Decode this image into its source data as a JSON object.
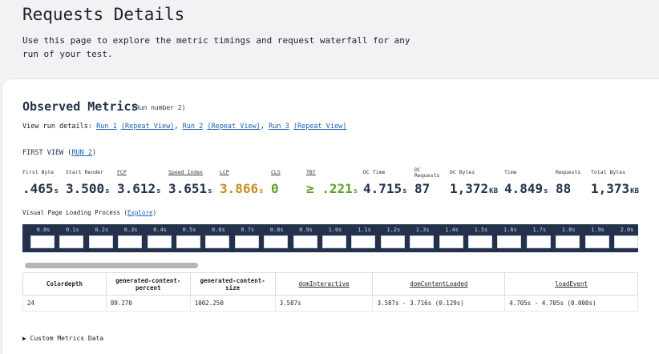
{
  "page": {
    "title": "Requests Details",
    "description": "Use this page to explore the metric timings and request waterfall for any run of your test."
  },
  "observed": {
    "title": "Observed Metrics",
    "run_number": "(Run number 2)",
    "run_details_label": "View run details:",
    "runs": [
      {
        "label": "Run 1",
        "repeat": "(Repeat View)"
      },
      {
        "label": "Run 2",
        "repeat": "(Repeat View)"
      },
      {
        "label": "Run 3",
        "repeat": "(Repeat View)"
      }
    ],
    "first_view_label": "FIRST VIEW",
    "first_view_run": "RUN 2"
  },
  "metrics": [
    {
      "label": "First Byte",
      "value": ".465",
      "unit": "s",
      "color": "#23324a"
    },
    {
      "label": "Start Render",
      "value": "3.500",
      "unit": "s",
      "color": "#23324a"
    },
    {
      "label": "FCP",
      "value": "3.612",
      "unit": "s",
      "color": "#23324a"
    },
    {
      "label": "Speed Index",
      "value": "3.651",
      "unit": "s",
      "color": "#23324a"
    },
    {
      "label": "LCP",
      "value": "3.866",
      "unit": "s",
      "color": "#c98a1b"
    },
    {
      "label": "CLS",
      "value": "0",
      "unit": "",
      "color": "#5aa02c"
    },
    {
      "label": "TBT",
      "value": "≥ .221",
      "unit": "s",
      "color": "#5aa02c"
    },
    {
      "label": "DC Time",
      "value": "4.715",
      "unit": "s",
      "color": "#23324a"
    },
    {
      "label": "DC Requests",
      "value": "87",
      "unit": "",
      "color": "#23324a"
    },
    {
      "label": "DC Bytes",
      "value": "1,372",
      "unit": "KB",
      "color": "#23324a"
    },
    {
      "label": "Time",
      "value": "4.849",
      "unit": "s",
      "color": "#23324a"
    },
    {
      "label": "Requests",
      "value": "88",
      "unit": "",
      "color": "#23324a"
    },
    {
      "label": "Total Bytes",
      "value": "1,373",
      "unit": "KB",
      "color": "#23324a"
    }
  ],
  "visual": {
    "label": "Visual Page Loading Process",
    "explore_label": "Explore",
    "frames": [
      "0.0s",
      "0.1s",
      "0.2s",
      "0.3s",
      "0.4s",
      "0.5s",
      "0.6s",
      "0.7s",
      "0.8s",
      "0.9s",
      "1.0s",
      "1.1s",
      "1.2s",
      "1.3s",
      "1.4s",
      "1.5s",
      "1.6s",
      "1.7s",
      "1.8s",
      "1.9s",
      "2.0s"
    ]
  },
  "custom_table": {
    "headers": [
      "Colordepth",
      "generated-content-percent",
      "generated-content-size",
      "domInteractive",
      "domContentLoaded",
      "loadEvent"
    ],
    "row": [
      "24",
      "89.270",
      "1002.250",
      "3.587s",
      "3.587s - 3.716s (0.129s)",
      "4.705s - 4.705s (0.000s)"
    ]
  },
  "custom_metrics_label": "▶ Custom Metrics Data"
}
